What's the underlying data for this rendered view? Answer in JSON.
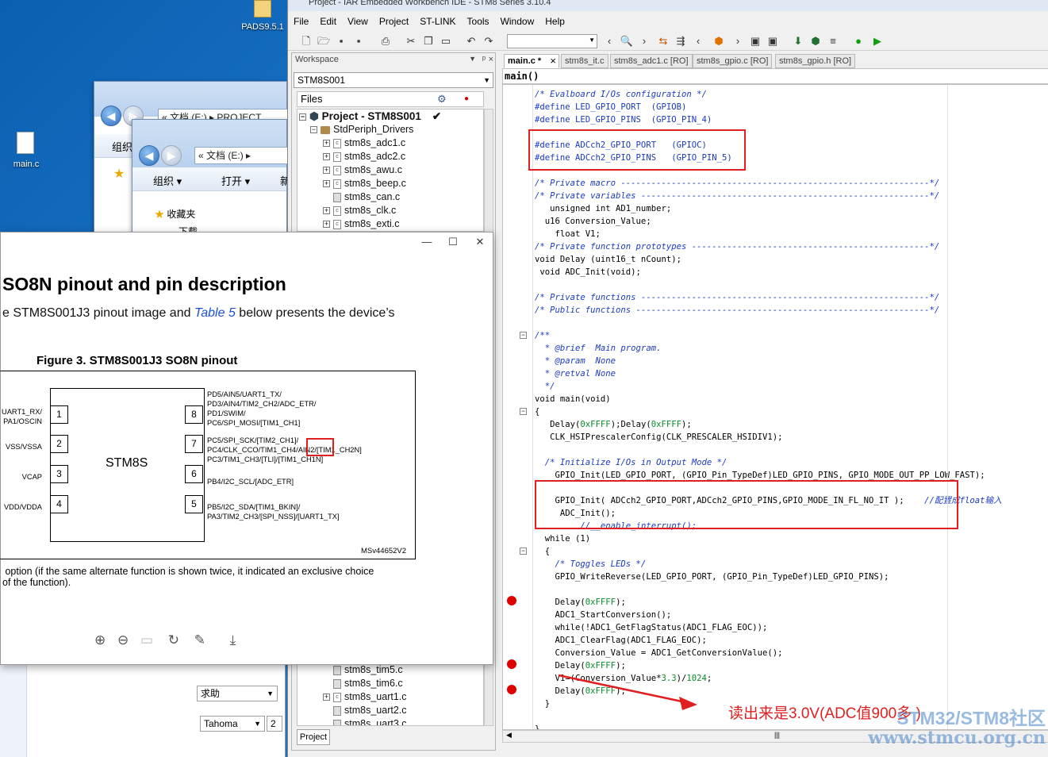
{
  "desktop": {
    "icons": [
      {
        "label": "PADS9.5.1"
      },
      {
        "label": "main.c"
      }
    ]
  },
  "explorer_back": {
    "address": [
      "«",
      "文档 (E:)",
      "▸",
      "PROJECT"
    ],
    "toolbar_label": "组织"
  },
  "explorer_front": {
    "address": [
      "«",
      "文档 (E:)",
      "▸"
    ],
    "toolbar": {
      "organize": "组织 ▾",
      "open": "打开 ▾",
      "new": "新"
    },
    "favorites": "收藏夹",
    "downloads": "下载"
  },
  "explorer_bottom": {
    "help_combo": "求助",
    "font_combo": "Tahoma",
    "size_combo": "2"
  },
  "iar": {
    "title": "Project - IAR Embedded Workbench IDE - STM8 Series 3.10.4",
    "menu": [
      "File",
      "Edit",
      "View",
      "Project",
      "ST-LINK",
      "Tools",
      "Window",
      "Help"
    ],
    "workspace": {
      "header": "Workspace",
      "config": "STM8S001",
      "files_header": "Files",
      "project": "Project - STM8S001",
      "group": "StdPeriph_Drivers",
      "files_top": [
        "stm8s_adc1.c",
        "stm8s_adc2.c",
        "stm8s_awu.c",
        "stm8s_beep.c",
        "stm8s_can.c",
        "stm8s_clk.c",
        "stm8s_exti.c"
      ],
      "files_bottom": [
        "stm8s_tim5.c",
        "stm8s_tim6.c",
        "stm8s_uart1.c",
        "stm8s_uart2.c",
        "stm8s_uart3.c"
      ],
      "bottom_tab": "Project"
    },
    "tabs": [
      "main.c *",
      "stm8s_it.c",
      "stm8s_adc1.c [RO]",
      "stm8s_gpio.c [RO]",
      "stm8s_gpio.h [RO]"
    ],
    "function_bar": "main()",
    "code": [
      "/* Evalboard I/Os configuration */",
      "#define LED_GPIO_PORT  (GPIOB)",
      "#define LED_GPIO_PINS  (GPIO_PIN_4)",
      "",
      "#define ADCch2_GPIO_PORT   (GPIOC)",
      "#define ADCch2_GPIO_PINS   (GPIO_PIN_5)",
      "",
      "/* Private macro -------------------------------------------------------------*/",
      "/* Private variables ---------------------------------------------------------*/",
      "   unsigned int AD1_number;",
      "  u16 Conversion_Value;",
      "    float V1;",
      "/* Private function prototypes -----------------------------------------------*/",
      "void Delay (uint16_t nCount);",
      " void ADC_Init(void);",
      "",
      "/* Private functions ---------------------------------------------------------*/",
      "/* Public functions ----------------------------------------------------------*/",
      "",
      "/**",
      "  * @brief  Main program.",
      "  * @param  None",
      "  * @retval None",
      "  */",
      "void main(void)",
      "{",
      "   Delay(0xFFFF);Delay(0xFFFF);",
      "   CLK_HSIPrescalerConfig(CLK_PRESCALER_HSIDIV1);",
      "",
      "  /* Initialize I/Os in Output Mode */",
      "    GPIO_Init(LED_GPIO_PORT, (GPIO_Pin_TypeDef)LED_GPIO_PINS, GPIO_MODE_OUT_PP_LOW_FAST);",
      "",
      "    GPIO_Init( ADCch2_GPIO_PORT,ADCch2_GPIO_PINS,GPIO_MODE_IN_FL_NO_IT );    //配置成float输入",
      "     ADC_Init();",
      "         //__enable_interrupt();",
      "  while (1)",
      "  {",
      "    /* Toggles LEDs */",
      "    GPIO_WriteReverse(LED_GPIO_PORT, (GPIO_Pin_TypeDef)LED_GPIO_PINS);",
      "",
      "    Delay(0xFFFF);",
      "    ADC1_StartConversion();",
      "    while(!ADC1_GetFlagStatus(ADC1_FLAG_EOC));",
      "    ADC1_ClearFlag(ADC1_FLAG_EOC);",
      "    Conversion_Value = ADC1_GetConversionValue();",
      "    Delay(0xFFFF);",
      "    V1=(Conversion_Value*3.3)/1024;",
      "    Delay(0xFFFF);",
      "  }",
      "",
      "}"
    ],
    "annotation": "读出来是3.0V(ADC值900多 )"
  },
  "pdf": {
    "heading": "SO8N pinout and pin description",
    "intro_pre": "e STM8S001J3 pinout image and ",
    "intro_link": "Table 5",
    "intro_post": " below presents the device’s",
    "figure_title": "Figure 3. STM8S001J3 SO8N pinout",
    "chip": "STM8S",
    "left_pins": [
      {
        "num": "1",
        "label": "UART1_RX/\nPA1/OSCIN"
      },
      {
        "num": "2",
        "label": "VSS/VSSA"
      },
      {
        "num": "3",
        "label": "VCAP"
      },
      {
        "num": "4",
        "label": "VDD/VDDA"
      }
    ],
    "right_pins": [
      {
        "num": "8",
        "label": "PD5/AIN5/UART1_TX/\nPD3/AIN4/TIM2_CH2/ADC_ETR/\nPD1/SWIM/\nPC6/SPI_MOSI/[TIM1_CH1]"
      },
      {
        "num": "7",
        "label": "PC5/SPI_SCK/[TIM2_CH1]/\nPC4/CLK_CCO/TIM1_CH4/AIN2/[TIM1_CH2N]\nPC3/TIM1_CH3/[TLI]/[TIM1_CH1N]"
      },
      {
        "num": "6",
        "label": "PB4/I2C_SCL/[ADC_ETR]"
      },
      {
        "num": "5",
        "label": "PB5/I2C_SDA/[TIM1_BKIN]/\nPA3/TIM2_CH3/[SPI_NSS]/[UART1_TX]"
      }
    ],
    "figure_id": "MSv44652V2",
    "footnote": " option (if the same alternate function is shown twice, it indicated an exclusive choice\nof the function)."
  },
  "watermark": {
    "line1": "STM32/STM8社区",
    "line2": "www.stmcu.org.cn"
  },
  "colors": {
    "annotation_red": "#e02020",
    "comment_blue": "#1a3bbf",
    "number_green": "#0a8a2a"
  }
}
